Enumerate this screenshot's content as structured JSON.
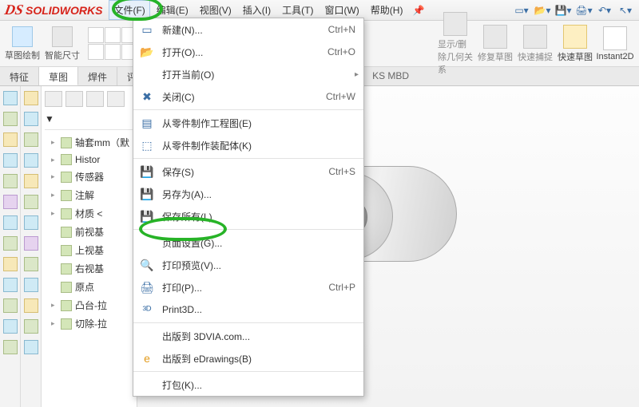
{
  "app": {
    "logo_text": "SOLIDWORKS"
  },
  "menubar": {
    "file": "文件(F)",
    "edit": "编辑(E)",
    "view": "视图(V)",
    "insert": "插入(I)",
    "tools": "工具(T)",
    "window": "窗口(W)",
    "help": "帮助(H)"
  },
  "sketch_tools": {
    "sketch": "草图绘制",
    "smart_dim": "智能尺寸"
  },
  "ribbon": {
    "show_delete": "显示/删除几何关系",
    "repair": "修复草图",
    "quick_snap": "快速捕捉",
    "quick_sketch": "快速草图",
    "instant2d": "Instant2D"
  },
  "tabs": {
    "feature": "特征",
    "sketch": "草图",
    "weld": "焊件",
    "evaluate": "评估",
    "mbd": "KS MBD"
  },
  "tree": {
    "root": "轴套mm（默",
    "history": "Histor",
    "sensors": "传感器",
    "annotations": "注解",
    "material": "材质 <",
    "front": "前视基",
    "top": "上视基",
    "right": "右视基",
    "origin": "原点",
    "boss": "凸台-拉",
    "cut": "切除-拉"
  },
  "file_menu": {
    "new": {
      "label": "新建(N)...",
      "shortcut": "Ctrl+N"
    },
    "open": {
      "label": "打开(O)...",
      "shortcut": "Ctrl+O"
    },
    "open_recent": {
      "label": "打开当前(O)",
      "shortcut": ""
    },
    "close": {
      "label": "关闭(C)",
      "shortcut": "Ctrl+W"
    },
    "make_drw": {
      "label": "从零件制作工程图(E)",
      "shortcut": ""
    },
    "make_asm": {
      "label": "从零件制作装配体(K)",
      "shortcut": ""
    },
    "save": {
      "label": "保存(S)",
      "shortcut": "Ctrl+S"
    },
    "save_as": {
      "label": "另存为(A)...",
      "shortcut": ""
    },
    "save_all": {
      "label": "保存所有(L)",
      "shortcut": ""
    },
    "page_setup": {
      "label": "页面设置(G)...",
      "shortcut": ""
    },
    "print_prev": {
      "label": "打印预览(V)...",
      "shortcut": ""
    },
    "print": {
      "label": "打印(P)...",
      "shortcut": "Ctrl+P"
    },
    "print3d": {
      "label": "Print3D...",
      "shortcut": ""
    },
    "pub_3dvia": {
      "label": "出版到 3DVIA.com...",
      "shortcut": ""
    },
    "pub_edrw": {
      "label": "出版到 eDrawings(B)",
      "shortcut": ""
    },
    "pack": {
      "label": "打包(K)...",
      "shortcut": ""
    }
  }
}
